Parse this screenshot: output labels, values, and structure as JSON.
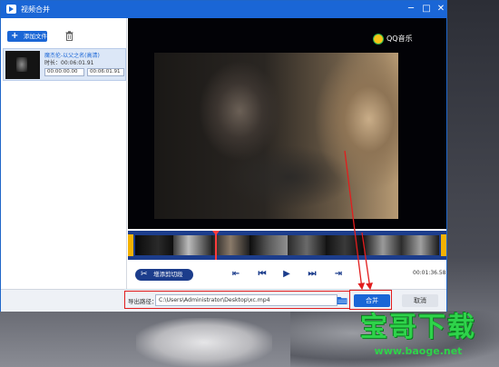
{
  "window": {
    "title": "视频合并",
    "minimize_label": "─",
    "maximize_label": "□",
    "close_label": "✕"
  },
  "sidebar": {
    "add_file_label": "添加文件",
    "files": [
      {
        "name": "魔杰伦-以父之名(高清)",
        "duration": "时长：00:06:01.91",
        "start_time": "00:00:00.00",
        "end_time": "00:06:01.91"
      }
    ]
  },
  "preview": {
    "watermark_text": "QQ音乐"
  },
  "controls": {
    "split_label": "增添剪切段",
    "current_time": "00:01:36.58"
  },
  "footer": {
    "path_label": "导出路径：",
    "path_value": "C:\\Users\\Administrator\\Desktop\\xc.mp4",
    "merge_label": "合并",
    "cancel_label": "取消"
  },
  "site_watermark": {
    "title": "宝哥下载",
    "url": "www.baoge.net"
  },
  "colors": {
    "titlebar": "#1a66d6",
    "accent": "#1c3d8c",
    "trim_handle": "#f3b100",
    "annotation": "#e21d1d",
    "watermark": "#2ed34a"
  }
}
